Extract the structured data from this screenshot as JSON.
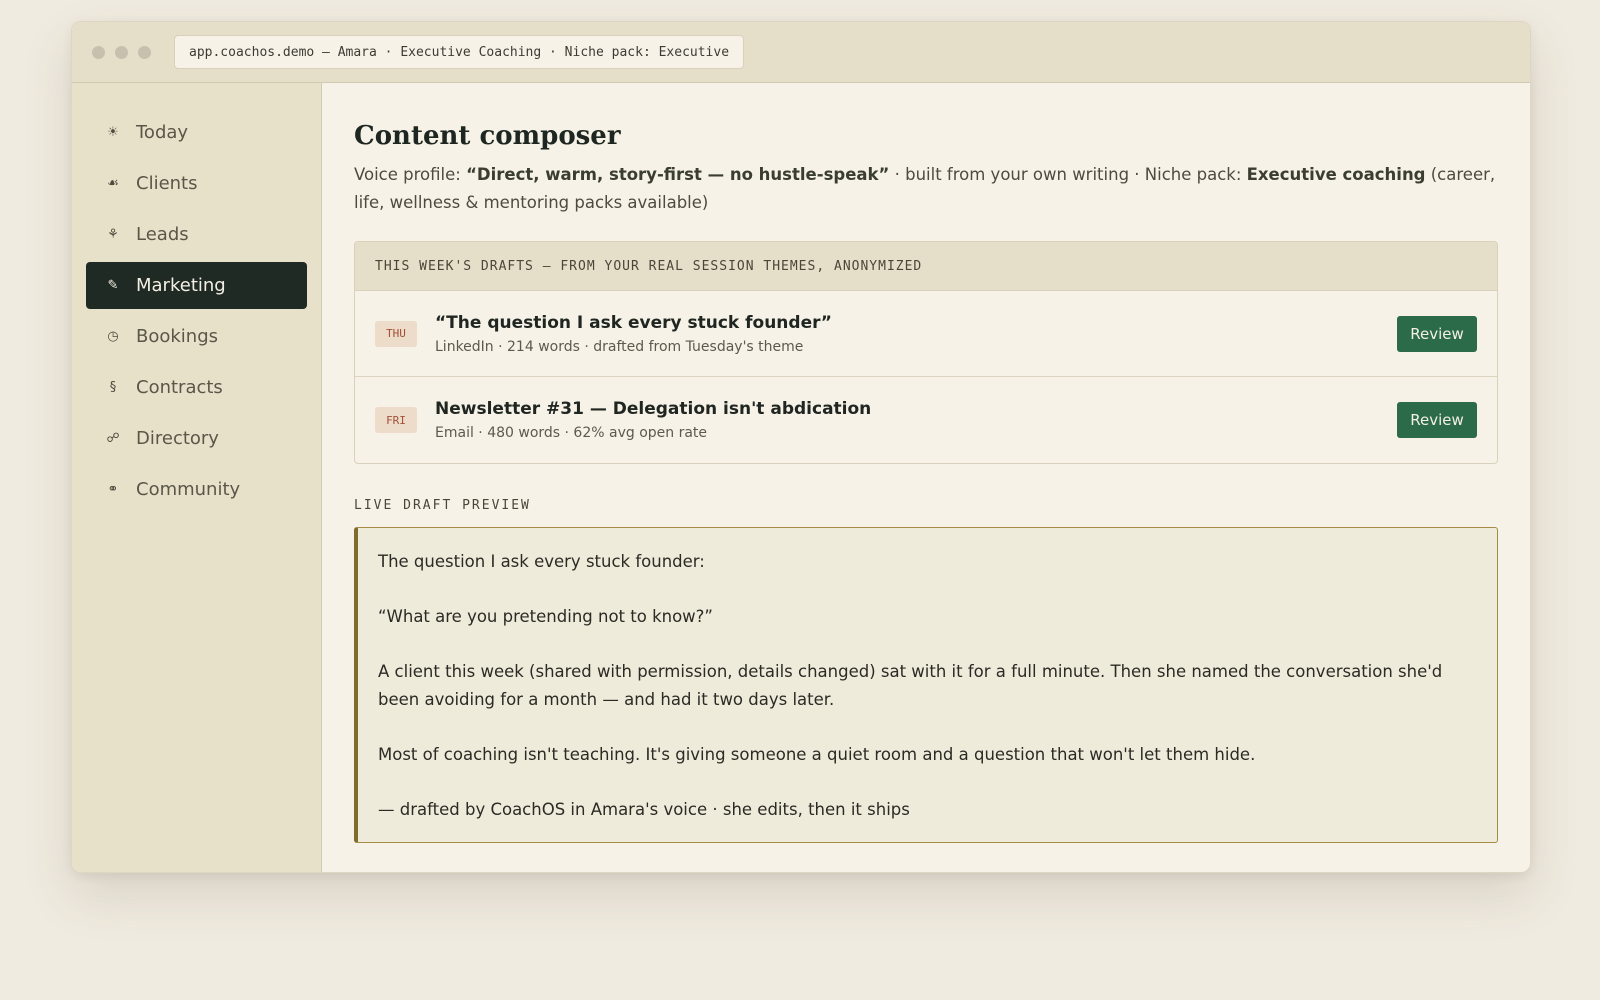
{
  "window": {
    "url": "app.coachos.demo — Amara · Executive Coaching · Niche pack: Executive"
  },
  "sidebar": {
    "items": [
      {
        "label": "Today",
        "icon": "sun-icon",
        "glyph": "☀"
      },
      {
        "label": "Clients",
        "icon": "clients-icon",
        "glyph": "☙"
      },
      {
        "label": "Leads",
        "icon": "leads-icon",
        "glyph": "⚘"
      },
      {
        "label": "Marketing",
        "icon": "pen-icon",
        "glyph": "✎",
        "active": true
      },
      {
        "label": "Bookings",
        "icon": "clock-icon",
        "glyph": "◷"
      },
      {
        "label": "Contracts",
        "icon": "section-icon",
        "glyph": "§"
      },
      {
        "label": "Directory",
        "icon": "link-icon",
        "glyph": "☍"
      },
      {
        "label": "Community",
        "icon": "circles-icon",
        "glyph": "⚭"
      }
    ]
  },
  "main": {
    "title": "Content composer",
    "subtitle": {
      "prefix": "Voice profile: ",
      "voice": "“Direct, warm, story-first — no hustle-speak”",
      "middle": " · built from your own writing · Niche pack: ",
      "niche": "Executive coaching",
      "suffix": " (career, life, wellness & mentoring packs available)"
    },
    "drafts": {
      "header": "THIS WEEK'S DRAFTS — FROM YOUR REAL SESSION THEMES, ANONYMIZED",
      "items": [
        {
          "day": "THU",
          "title": "“The question I ask every stuck founder”",
          "meta": "LinkedIn · 214 words · drafted from Tuesday's theme",
          "action": "Review"
        },
        {
          "day": "FRI",
          "title": "Newsletter #31 — Delegation isn't abdication",
          "meta": "Email · 480 words · 62% avg open rate",
          "action": "Review"
        }
      ]
    },
    "preview": {
      "label": "LIVE DRAFT PREVIEW",
      "paragraphs": [
        "The question I ask every stuck founder:",
        "“What are you pretending not to know?”",
        "A client this week (shared with permission, details changed) sat with it for a full minute. Then she named the conversation she'd been avoiding for a month — and had it two days later.",
        "Most of coaching isn't teaching. It's giving someone a quiet room and a question that won't let them hide.",
        "— drafted by CoachOS in Amara's voice · she edits, then it ships"
      ]
    }
  },
  "colors": {
    "accent": "#2b6b4a",
    "active_nav": "#1f2a24",
    "preview_border": "#7f6c2f"
  }
}
